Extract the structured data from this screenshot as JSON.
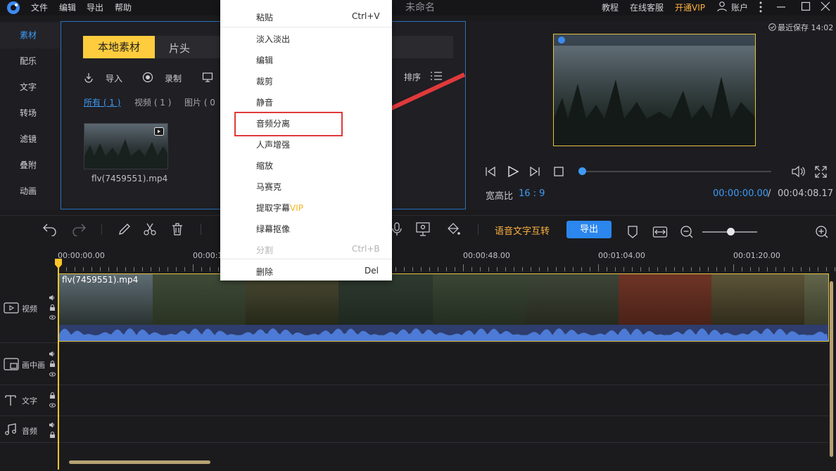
{
  "title_bar": {
    "menus": [
      "文件",
      "编辑",
      "导出",
      "帮助"
    ],
    "app_title": "未命名",
    "tutorial": "教程",
    "support": "在线客服",
    "vip": "开通VIP",
    "account": "账户"
  },
  "side_nav": {
    "items": [
      "素材",
      "配乐",
      "文字",
      "转场",
      "滤镜",
      "叠附",
      "动画"
    ]
  },
  "media": {
    "tabs": [
      "本地素材",
      "片头"
    ],
    "import": "导入",
    "record": "录制",
    "sort": "排序",
    "filters": [
      "所有 ( 1 )",
      "视频 ( 1 )",
      "图片 ( 0"
    ],
    "thumbnail_name": "flv(7459551).mp4"
  },
  "preview": {
    "autosave": "最近保存 14:02",
    "aspect_label": "宽高比",
    "aspect_value": "16 : 9",
    "current_time": "00:00:00.00",
    "separator": "/",
    "total_time": "00:04:08.17",
    "progress": 0
  },
  "toolbar": {
    "speech_text": "语音文字互转",
    "export_label": "导出"
  },
  "ruler": {
    "labels": [
      "00:00:00.00",
      "00:00:1",
      "00:00:48.00",
      "00:01:04.00",
      "00:01:20.00"
    ]
  },
  "tracks": {
    "video_label": "视频",
    "pip_label": "画中画",
    "text_label": "文字",
    "audio_label": "音频",
    "clip_name": "flv(7459551).mp4"
  },
  "context_menu": {
    "items": [
      {
        "label": "粘贴",
        "shortcut": "Ctrl+V"
      },
      {
        "label": "淡入淡出"
      },
      {
        "label": "编辑"
      },
      {
        "label": "裁剪"
      },
      {
        "label": "静音"
      },
      {
        "label": "音频分离"
      },
      {
        "label": "人声增强"
      },
      {
        "label": "缩放"
      },
      {
        "label": "马赛克"
      },
      {
        "label": "提取字幕"
      },
      {
        "label": "绿幕抠像"
      },
      {
        "label": "分割",
        "shortcut": "Ctrl+B"
      },
      {
        "label": "删除",
        "shortcut": "Del"
      }
    ],
    "vip_badge": "VIP"
  },
  "colors": {
    "accent_blue": "#3e9bf5",
    "vip_orange": "#ffb23f",
    "tab_yellow": "#ffcc3d",
    "highlight_red": "#e0393b"
  }
}
